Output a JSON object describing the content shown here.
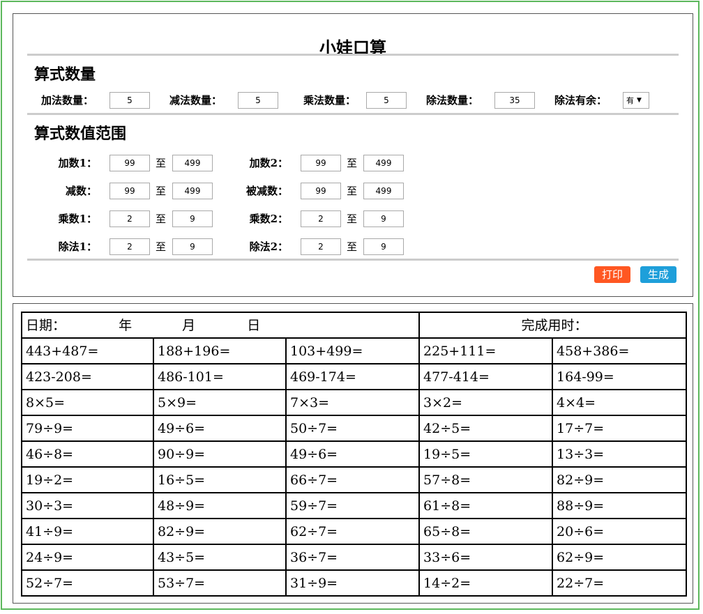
{
  "title": "小娃口算",
  "sections": {
    "count_title": "算式数量",
    "range_title": "算式数值范围"
  },
  "counts": {
    "add_label": "加法数量：",
    "add_value": "5",
    "sub_label": "减法数量：",
    "sub_value": "5",
    "mul_label": "乘法数量：",
    "mul_value": "5",
    "div_label": "除法数量：",
    "div_value": "35",
    "remainder_label": "除法有余：",
    "remainder_value": "有"
  },
  "to_label": "至",
  "ranges": [
    {
      "left": {
        "label": "加数1：",
        "min": "99",
        "max": "499"
      },
      "right": {
        "label": "加数2：",
        "min": "99",
        "max": "499"
      }
    },
    {
      "left": {
        "label": "减数：",
        "min": "99",
        "max": "499"
      },
      "right": {
        "label": "被减数：",
        "min": "99",
        "max": "499"
      }
    },
    {
      "left": {
        "label": "乘数1：",
        "min": "2",
        "max": "9"
      },
      "right": {
        "label": "乘数2：",
        "min": "2",
        "max": "9"
      }
    },
    {
      "left": {
        "label": "除法1：",
        "min": "2",
        "max": "9"
      },
      "right": {
        "label": "除法2：",
        "min": "2",
        "max": "9"
      }
    }
  ],
  "buttons": {
    "print": "打印",
    "generate": "生成"
  },
  "sheet": {
    "date_label": "日期：",
    "year": "年",
    "month": "月",
    "day": "日",
    "time_label": "完成用时：",
    "rows": [
      [
        "443+487=",
        "188+196=",
        "103+499=",
        "225+111=",
        "458+386="
      ],
      [
        "423-208=",
        "486-101=",
        "469-174=",
        "477-414=",
        "164-99="
      ],
      [
        "8×5=",
        "5×9=",
        "7×3=",
        "3×2=",
        "4×4="
      ],
      [
        "79÷9=",
        "49÷6=",
        "50÷7=",
        "42÷5=",
        "17÷7="
      ],
      [
        "46÷8=",
        "90÷9=",
        "49÷6=",
        "19÷5=",
        "13÷3="
      ],
      [
        "19÷2=",
        "16÷5=",
        "66÷7=",
        "57÷8=",
        "82÷9="
      ],
      [
        "30÷3=",
        "48÷9=",
        "59÷7=",
        "61÷8=",
        "88÷9="
      ],
      [
        "41÷9=",
        "82÷9=",
        "62÷7=",
        "65÷8=",
        "20÷6="
      ],
      [
        "24÷9=",
        "43÷5=",
        "36÷7=",
        "33÷6=",
        "62÷9="
      ],
      [
        "52÷7=",
        "53÷7=",
        "31÷9=",
        "14÷2=",
        "22÷7="
      ]
    ]
  }
}
